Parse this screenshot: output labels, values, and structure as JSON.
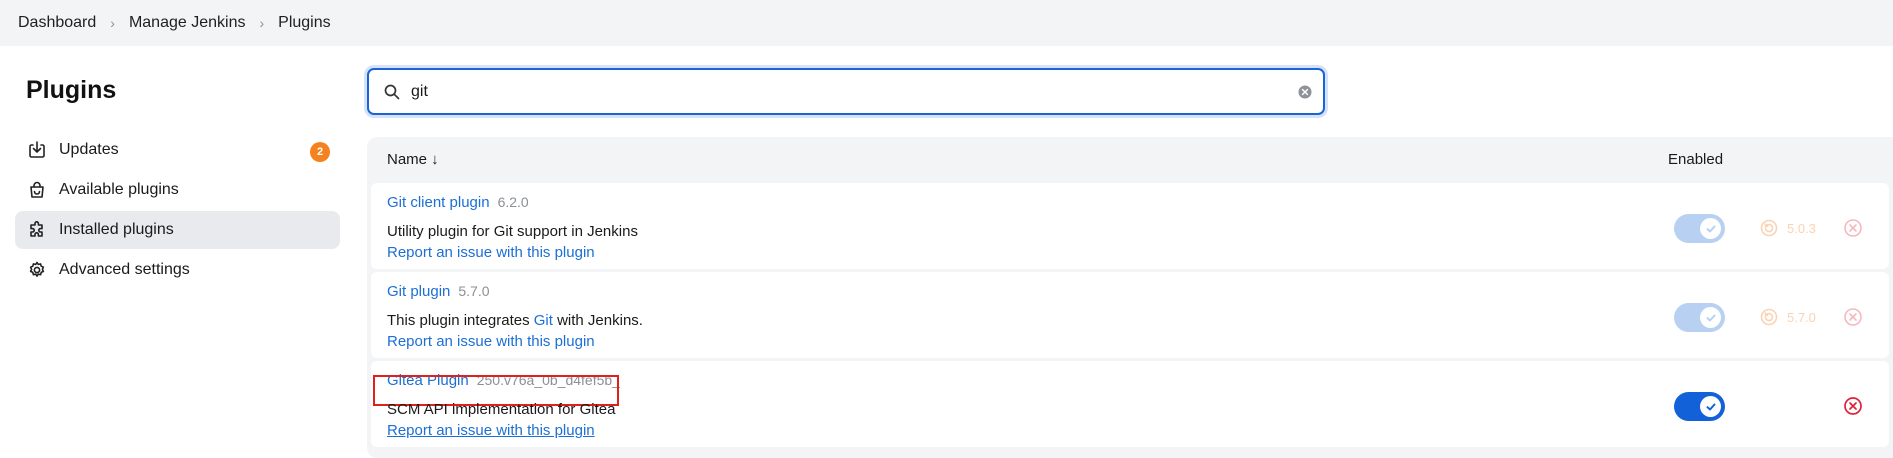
{
  "breadcrumb": {
    "items": [
      "Dashboard",
      "Manage Jenkins",
      "Plugins"
    ]
  },
  "page_title": "Plugins",
  "sidebar": {
    "items": [
      {
        "label": "Updates",
        "icon": "download-icon",
        "badge": "2",
        "active": false
      },
      {
        "label": "Available plugins",
        "icon": "shopping-bag-icon",
        "active": false
      },
      {
        "label": "Installed plugins",
        "icon": "puzzle-icon",
        "active": true
      },
      {
        "label": "Advanced settings",
        "icon": "gear-icon",
        "active": false
      }
    ]
  },
  "search": {
    "value": "git",
    "icon": "search-icon"
  },
  "table": {
    "col_name": "Name ↓",
    "col_enabled": "Enabled",
    "rows": [
      {
        "name": "Git client plugin",
        "version": "6.2.0",
        "desc_before": "Utility plugin for Git support in Jenkins",
        "desc_link": "",
        "desc_after": "",
        "report": "Report an issue with this plugin",
        "enabled": true,
        "toggle_disabled": true,
        "downgrade_version": "5.0.3",
        "uninstall_disabled": true
      },
      {
        "name": "Git plugin",
        "version": "5.7.0",
        "desc_before": "This plugin integrates ",
        "desc_link": "Git",
        "desc_after": " with Jenkins.",
        "report": "Report an issue with this plugin",
        "enabled": true,
        "toggle_disabled": true,
        "downgrade_version": "5.7.0",
        "uninstall_disabled": true
      },
      {
        "name": "Gitea Plugin",
        "version": "250.v76a_0b_d4fef5b_",
        "desc_before": "SCM API implementation for Gitea",
        "desc_link": "",
        "desc_after": "",
        "report": "Report an issue with this plugin",
        "enabled": true,
        "toggle_disabled": false,
        "downgrade_version": "",
        "uninstall_disabled": false
      }
    ]
  },
  "colors": {
    "link": "#1c6fd6",
    "toggle_on": "#1361d8",
    "toggle_disabled": "#b8d0f2",
    "badge": "#f5821f",
    "highlight": "#e0201a",
    "uninstall_active": "#e0203a",
    "uninstall_disabled": "#f4b8bf"
  }
}
